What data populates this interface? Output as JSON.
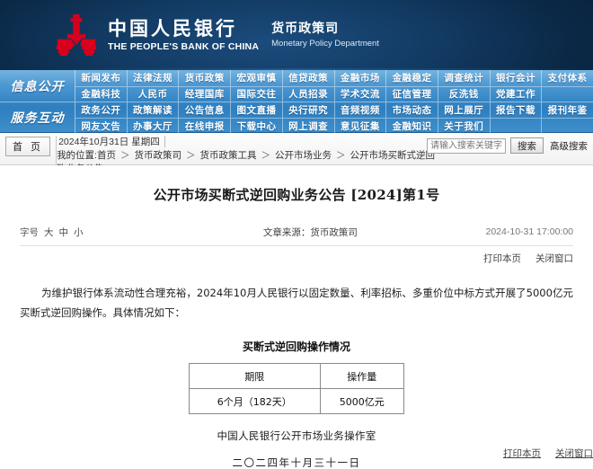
{
  "header": {
    "bank_name_cn": "中国人民银行",
    "bank_name_en": "THE PEOPLE'S BANK OF CHINA",
    "department_cn": "货币政策司",
    "department_en": "Monetary Policy Department",
    "logo_color": "#d8001d",
    "background_color": "#0a2744"
  },
  "nav": {
    "sections": [
      {
        "label": "信息公开",
        "rows": [
          [
            "新闻发布",
            "法律法规",
            "货币政策",
            "宏观审慎",
            "信贷政策",
            "金融市场",
            "金融稳定",
            "调查统计",
            "银行会计",
            "支付体系"
          ],
          [
            "金融科技",
            "人民币",
            "经理国库",
            "国际交往",
            "人员招录",
            "学术交流",
            "征信管理",
            "反洗钱",
            "党建工作",
            ""
          ]
        ]
      },
      {
        "label": "服务互动",
        "rows": [
          [
            "政务公开",
            "政策解读",
            "公告信息",
            "图文直播",
            "央行研究",
            "音频视频",
            "市场动态",
            "网上展厅",
            "报告下载",
            "报刊年鉴"
          ],
          [
            "网友文告",
            "办事大厅",
            "在线申报",
            "下载中心",
            "网上调查",
            "意见征集",
            "金融知识",
            "关于我们",
            "",
            ""
          ]
        ]
      }
    ]
  },
  "crumb": {
    "home_label": "首 页",
    "date": "2024年10月31日 星期四",
    "my_location": "我的位置:首页",
    "path": [
      "货币政策司",
      "货币政策工具",
      "公开市场业务",
      "公开市场买断式逆回购业务公告"
    ],
    "arrow": "＞"
  },
  "search": {
    "placeholder": "请输入搜索关键字",
    "value": "",
    "button_label": "搜索",
    "advanced_label": "高级搜索"
  },
  "article": {
    "title": "公开市场买断式逆回购业务公告  [2024]第1号",
    "font_size_label": "字号",
    "font_size_options": [
      "大",
      "中",
      "小"
    ],
    "source": "文章来源：货币政策司",
    "timestamp": "2024-10-31 17:00:00",
    "print_label": "打印本页",
    "close_label": "关闭窗口",
    "body": "为维护银行体系流动性合理充裕，2024年10月人民银行以固定数量、利率招标、多重价位中标方式开展了5000亿元买断式逆回购操作。具体情况如下：",
    "table": {
      "caption": "买断式逆回购操作情况",
      "columns": [
        "期限",
        "操作量"
      ],
      "rows": [
        [
          "6个月（182天）",
          "5000亿元"
        ]
      ]
    },
    "signature_org": "中国人民银行公开市场业务操作室",
    "signature_date": "二〇二四年十月三十一日",
    "bottom_print_label": "打印本页",
    "bottom_close_label": "关闭窗口"
  }
}
